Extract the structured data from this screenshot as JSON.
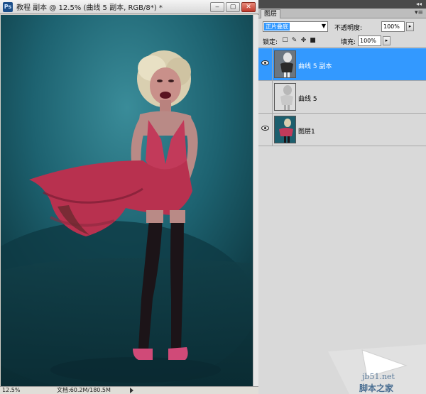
{
  "document": {
    "app_icon": "Ps",
    "title": "教程 副本 @ 12.5% (曲线 5 副本, RGB/8*) *",
    "window_buttons": {
      "minimize": "‒",
      "restore": "▢",
      "close": "✕"
    },
    "status": {
      "zoom": "12.5%",
      "doc_size": "文档:60.2M/180.5M"
    }
  },
  "layers_panel": {
    "tab_label": "图层",
    "collapse_glyph": "◂◂",
    "menu_glyph": "▾≡",
    "blend_mode": "正片叠底",
    "opacity_label": "不透明度:",
    "opacity_value": "100%",
    "lock_label": "锁定:",
    "fill_label": "填充:",
    "fill_value": "100%",
    "lock_icons": [
      "lock-transparent-icon",
      "lock-brush-icon",
      "lock-move-icon",
      "lock-all-icon"
    ],
    "layers": [
      {
        "name": "曲线 5 副本",
        "selected": true,
        "visible": true,
        "thumb": "portrait-inverted"
      },
      {
        "name": "曲线 5",
        "selected": false,
        "visible": false,
        "thumb": "portrait-light"
      },
      {
        "name": "图层1",
        "selected": false,
        "visible": true,
        "thumb": "portrait-color"
      }
    ]
  },
  "watermark": {
    "site": "jb51.net",
    "name": "脚本之家"
  },
  "colors": {
    "selection": "#3399ff",
    "canvas_bg": "#1c5f6c",
    "dress": "#c23a5a"
  }
}
